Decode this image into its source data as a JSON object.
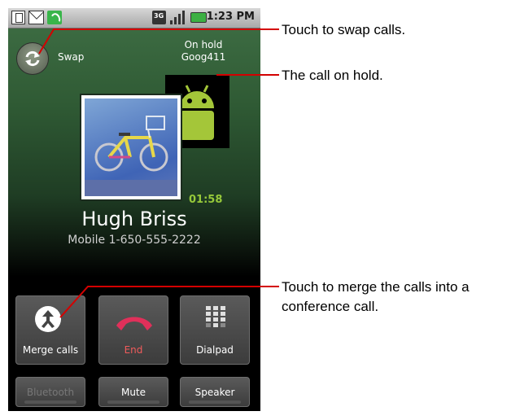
{
  "status_bar": {
    "time": "1:23 PM",
    "network": "3G"
  },
  "swap": {
    "label": "Swap"
  },
  "on_hold": {
    "status": "On hold",
    "name": "Goog411"
  },
  "active_call": {
    "timer": "01:58",
    "caller_name": "Hugh Briss",
    "caller_number": "Mobile 1-650-555-2222"
  },
  "buttons": {
    "merge": "Merge calls",
    "end": "End",
    "dialpad": "Dialpad",
    "bluetooth": "Bluetooth",
    "mute": "Mute",
    "speaker": "Speaker"
  },
  "callouts": {
    "swap": "Touch to swap calls.",
    "hold": "The call on hold.",
    "merge_line1": "Touch to merge the calls into a",
    "merge_line2": "conference call."
  },
  "colors": {
    "callout_line": "#d40000",
    "timer": "#97c93a",
    "end": "#f05b5b"
  }
}
